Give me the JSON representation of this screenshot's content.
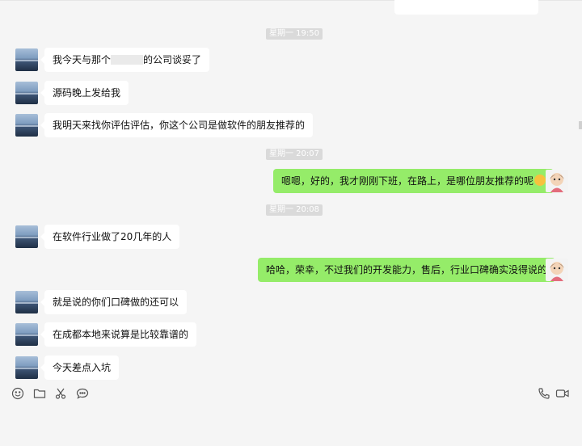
{
  "times": [
    "星期一 19:50",
    "星期一 20:07",
    "星期一 20:08"
  ],
  "messages": {
    "m1_before": "我今天与那个",
    "m1_after": "的公司谈妥了",
    "m2": "源码晚上发给我",
    "m3": "我明天来找你评估评估，你这个公司是做软件的朋友推荐的",
    "m4": "嗯嗯，好的，我才刚刚下班，在路上，是哪位朋友推荐的呢",
    "m5": "在软件行业做了20几年的人",
    "m6": "哈哈，荣幸，不过我们的开发能力，售后，行业口碑确实没得说的",
    "m7": "就是说的你们口碑做的还可以",
    "m8": "在成都本地来说算是比较靠谱的",
    "m9": "今天差点入坑"
  },
  "icons": {
    "emoji": "emoji-icon",
    "folder": "folder-icon",
    "scissors": "scissors-icon",
    "chat": "chat-icon",
    "phone": "phone-icon",
    "video": "video-icon"
  },
  "colors": {
    "background": "#f5f5f5",
    "bubble_left": "#ffffff",
    "bubble_right": "#95ec69",
    "timestamp_bg": "#dadada"
  }
}
